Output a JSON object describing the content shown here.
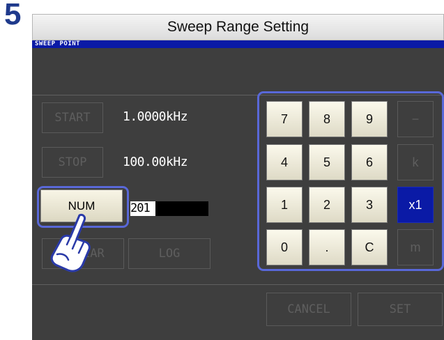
{
  "step_number": "5",
  "window_title": "Sweep Range Setting",
  "screen_header": "SWEEP POINT",
  "rows": {
    "start": {
      "label": "START",
      "value": "1.0000kHz"
    },
    "stop": {
      "label": "STOP",
      "value": "100.00kHz"
    },
    "num": {
      "label": "NUM",
      "value": "201"
    }
  },
  "mode_buttons": {
    "linear_label": "LINEAR",
    "log_label": "LOG"
  },
  "keypad": {
    "k7": "7",
    "k8": "8",
    "k9": "9",
    "minus": "−",
    "k4": "4",
    "k5": "5",
    "k6": "6",
    "kilo": "k",
    "k1": "1",
    "k2": "2",
    "k3": "3",
    "x1": "x1",
    "k0": "0",
    "dot": ".",
    "clear": "C",
    "milli": "m"
  },
  "footer": {
    "cancel_label": "CANCEL",
    "set_label": "SET"
  },
  "icons": {
    "pointer": "pointing-hand-icon"
  },
  "colors": {
    "accent": "#0a1aa6",
    "highlight": "#5968d8",
    "screen_bg": "#3e3e3e"
  }
}
